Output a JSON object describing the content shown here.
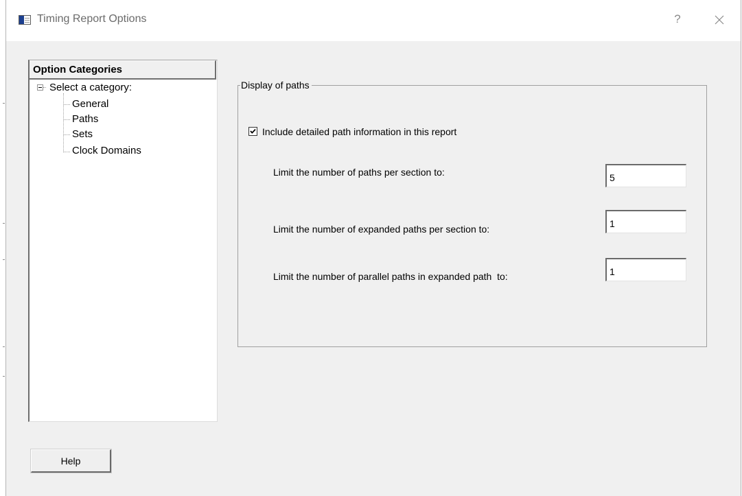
{
  "window": {
    "title": "Timing Report Options",
    "title_icon": "dialog-window-icon",
    "help_glyph": "?",
    "close_icon": "close-icon"
  },
  "categories": {
    "header": "Option Categories",
    "root_label": "Select a category:",
    "toggle_icon": "tree-collapse-icon",
    "items": [
      {
        "label": "General"
      },
      {
        "label": "Paths"
      },
      {
        "label": "Sets"
      },
      {
        "label": "Clock Domains"
      }
    ],
    "selected": "Paths"
  },
  "paths_panel": {
    "group_title": "Display of paths",
    "include_detail": {
      "label": "Include detailed path information in this report",
      "checked": true
    },
    "fields": [
      {
        "label": "Limit the number of paths per section to:",
        "value": "5"
      },
      {
        "label": "Limit the number of expanded paths per section to:",
        "value": "1"
      },
      {
        "label": "Limit the number of parallel paths in expanded path  to:",
        "value": "1"
      }
    ]
  },
  "footer": {
    "help_label": "Help"
  },
  "colors": {
    "dialog_background": "#f0f0f0",
    "title_text": "#6b6b6b",
    "title_icon_accent": "#1c3f8f"
  }
}
